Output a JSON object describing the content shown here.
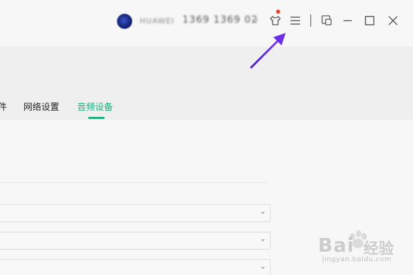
{
  "titlebar": {
    "username": "HUAWEI",
    "phone": "1369 1369 02",
    "icons": {
      "skin": "tshirt-icon",
      "menu": "hamburger-menu-icon",
      "mini_mode": "mini-mode-icon",
      "minimize": "minimize-icon",
      "maximize": "maximize-icon",
      "close": "close-icon"
    }
  },
  "tabs": [
    {
      "label": "件"
    },
    {
      "label": "网络设置"
    },
    {
      "label": "音频设备",
      "active": true
    }
  ],
  "colors": {
    "accent": "#1fae7d",
    "notification_dot": "#e8452c",
    "annotation_arrow": "#5a1fd6"
  },
  "watermark": {
    "brand": "Bai",
    "text": "经验",
    "url": "jingyan.baidu.com"
  }
}
